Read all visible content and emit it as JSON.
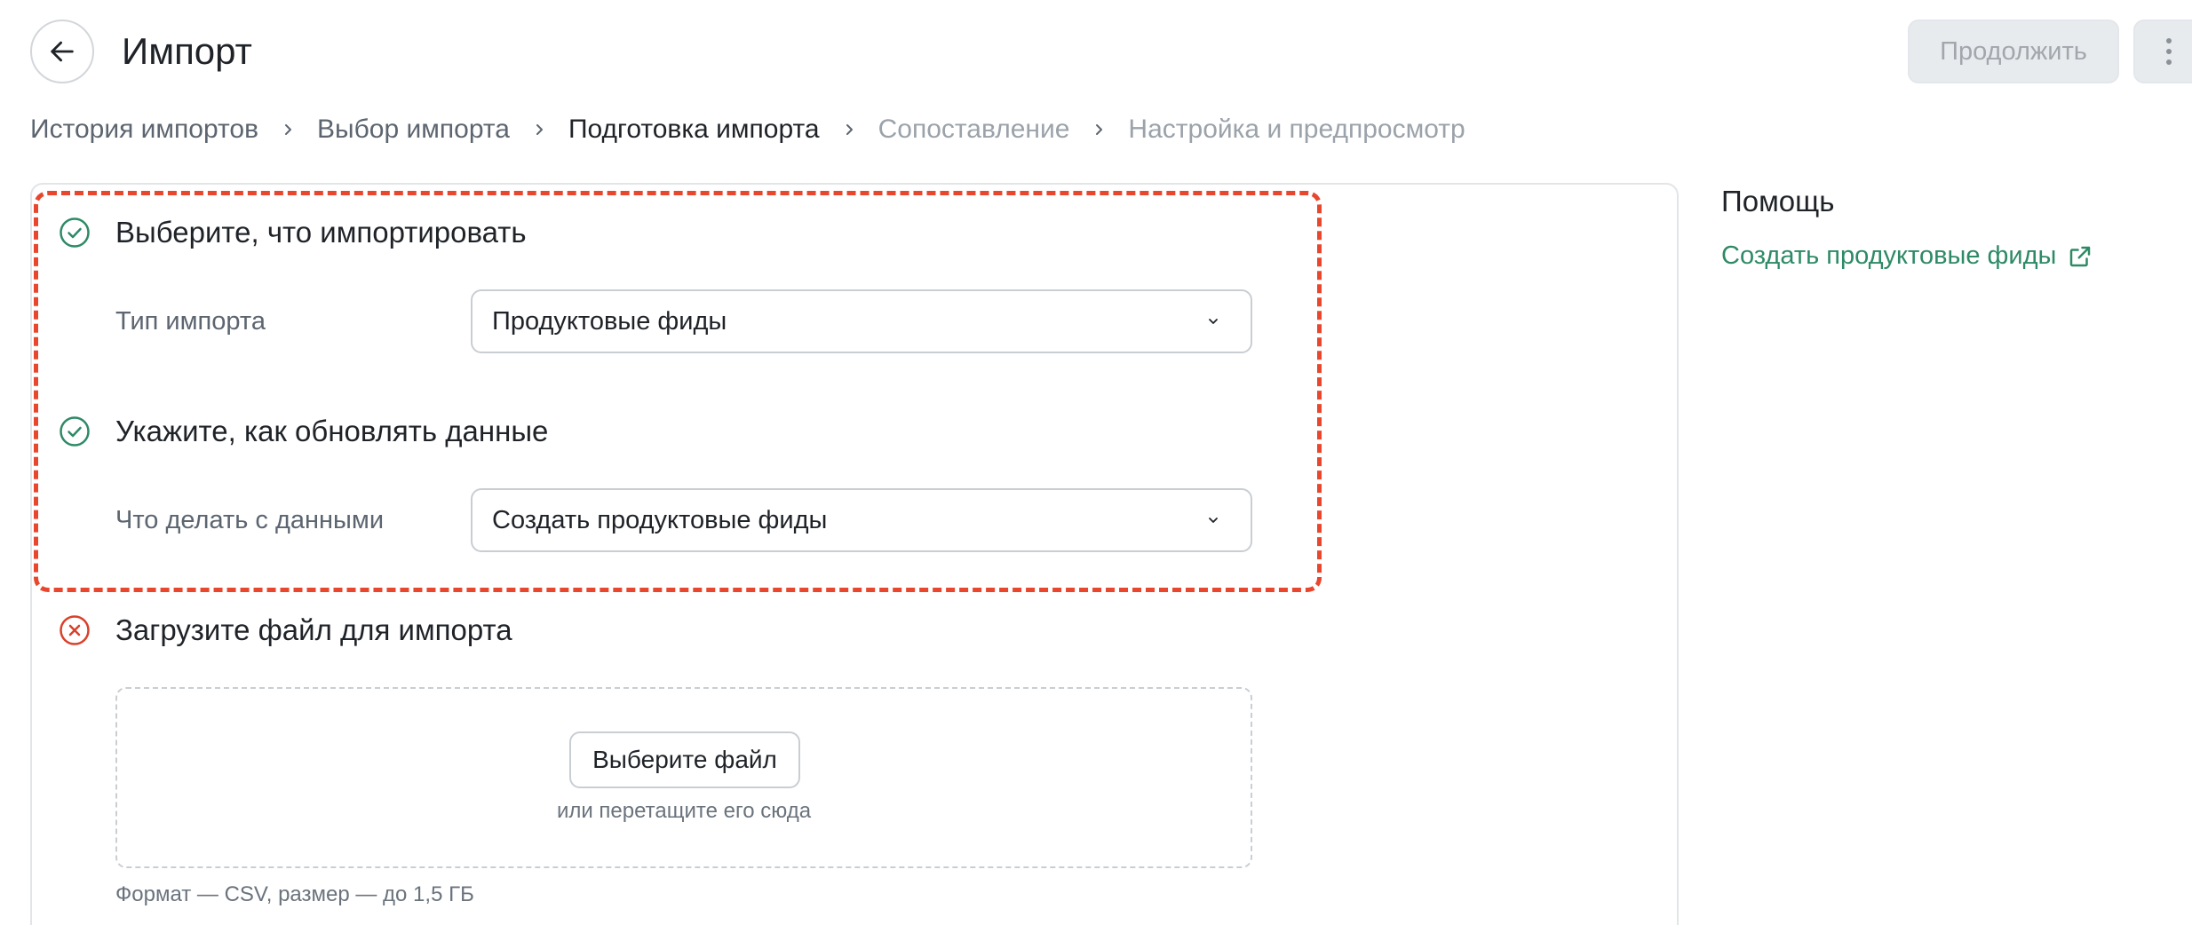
{
  "header": {
    "title": "Импорт",
    "continue_label": "Продолжить"
  },
  "breadcrumb": [
    {
      "label": "История импортов",
      "state": "link"
    },
    {
      "label": "Выбор импорта",
      "state": "link"
    },
    {
      "label": "Подготовка импорта",
      "state": "active"
    },
    {
      "label": "Сопоставление",
      "state": "disabled"
    },
    {
      "label": "Настройка и предпросмотр",
      "state": "disabled"
    }
  ],
  "sections": {
    "what": {
      "title": "Выберите, что импортировать",
      "status": "complete",
      "field_label": "Тип импорта",
      "value": "Продуктовые фиды"
    },
    "how": {
      "title": "Укажите, как обновлять данные",
      "status": "complete",
      "field_label": "Что делать с данными",
      "value": "Создать продуктовые фиды"
    },
    "upload": {
      "title": "Загрузите файл для импорта",
      "status": "error",
      "button_label": "Выберите файл",
      "drop_hint": "или перетащите его сюда",
      "format_note": "Формат — CSV, размер — до 1,5 ГБ"
    }
  },
  "help": {
    "title": "Помощь",
    "link_label": "Создать продуктовые фиды"
  },
  "colors": {
    "success": "#2e8a66",
    "error": "#d9412b",
    "highlight": "#e8472d",
    "link": "#2e8a66"
  }
}
